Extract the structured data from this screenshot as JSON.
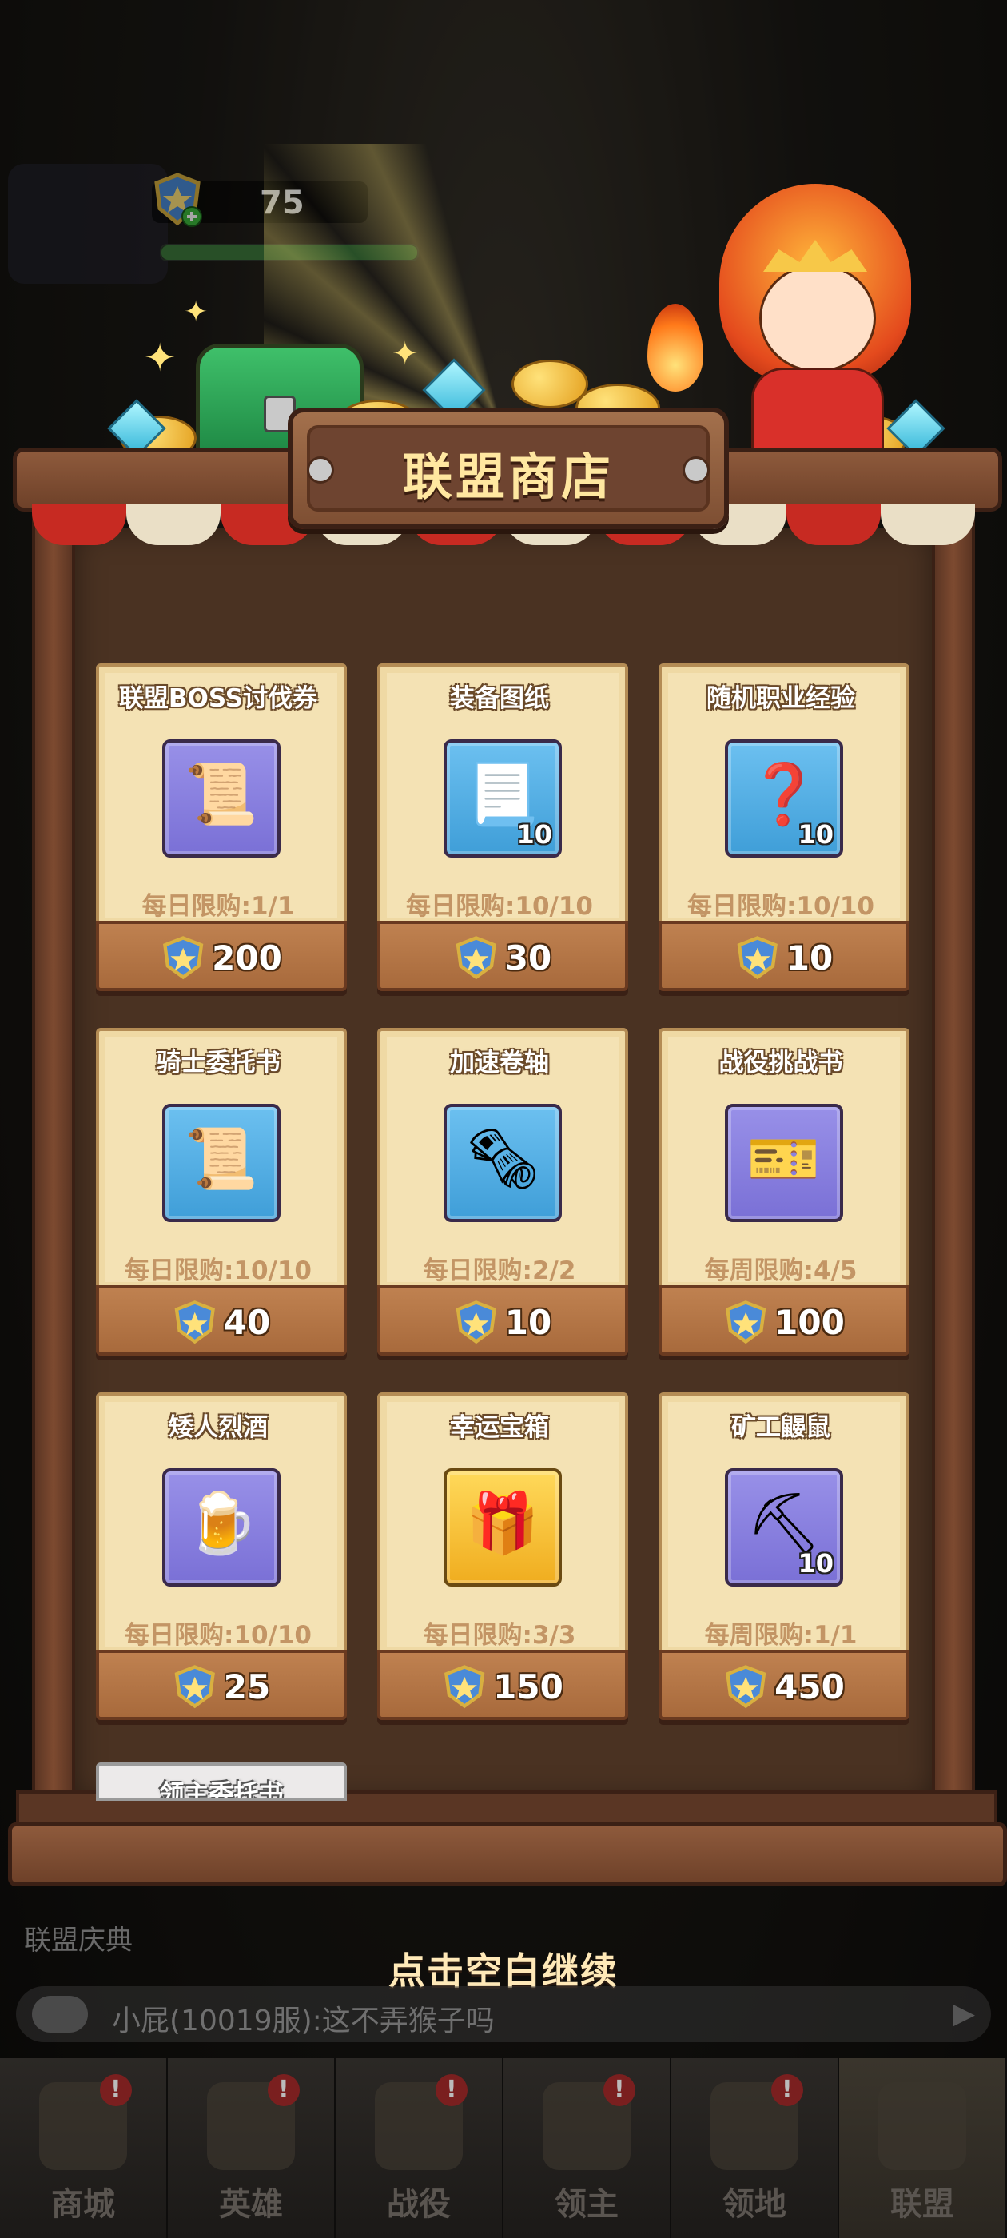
{
  "hud": {
    "alliance_points": "75",
    "emblem_icon": "dragon-shield-icon"
  },
  "shop": {
    "title": "联盟商店",
    "currency_icon": "alliance-shield-icon",
    "items": [
      {
        "name": "联盟BOSS讨伐券",
        "icon": "boss-scroll-icon",
        "count": "",
        "limit": "每日限购:1/1",
        "price": "200",
        "bg": "purple"
      },
      {
        "name": "装备图纸",
        "icon": "blueprint-icon",
        "count": "10",
        "limit": "每日限购:10/10",
        "price": "30",
        "bg": "blue"
      },
      {
        "name": "随机职业经验",
        "icon": "mystery-orb-icon",
        "count": "10",
        "limit": "每日限购:10/10",
        "price": "10",
        "bg": "blue"
      },
      {
        "name": "骑士委托书",
        "icon": "sealed-scroll-icon",
        "count": "",
        "limit": "每日限购:10/10",
        "price": "40",
        "bg": "blue"
      },
      {
        "name": "加速卷轴",
        "icon": "speed-scroll-icon",
        "count": "",
        "limit": "每日限购:2/2",
        "price": "10",
        "bg": "blue"
      },
      {
        "name": "战役挑战书",
        "icon": "challenge-ticket-icon",
        "count": "",
        "limit": "每周限购:4/5",
        "price": "100",
        "bg": "purple"
      },
      {
        "name": "矮人烈酒",
        "icon": "ale-mug-icon",
        "count": "",
        "limit": "每日限购:10/10",
        "price": "25",
        "bg": "purple"
      },
      {
        "name": "幸运宝箱",
        "icon": "lucky-chest-icon",
        "count": "",
        "limit": "每日限购:3/3",
        "price": "150",
        "bg": "gold"
      },
      {
        "name": "矿工鼹鼠",
        "icon": "miner-mole-icon",
        "count": "10",
        "limit": "每周限购:1/1",
        "price": "450",
        "bg": "purple"
      }
    ],
    "next_item_partial": "领主委托书"
  },
  "behind": {
    "celebration_label": "联盟庆典",
    "chat_message": "小屁(10019服):这不弄猴子吗"
  },
  "continue_hint": "点击空白继续",
  "nav": {
    "tabs": [
      {
        "label": "商城",
        "icon": "shop-icon",
        "alert": "!"
      },
      {
        "label": "英雄",
        "icon": "hero-icon",
        "alert": "!"
      },
      {
        "label": "战役",
        "icon": "battle-icon",
        "alert": "!"
      },
      {
        "label": "领主",
        "icon": "lord-icon",
        "alert": "!"
      },
      {
        "label": "领地",
        "icon": "castle-icon",
        "alert": "!"
      },
      {
        "label": "联盟",
        "icon": "knight-helmet-icon",
        "alert": ""
      }
    ]
  },
  "colors": {
    "paper": "#f4e2b4",
    "price_bar": "#bf8150",
    "title_text": "#ffe7a0"
  }
}
